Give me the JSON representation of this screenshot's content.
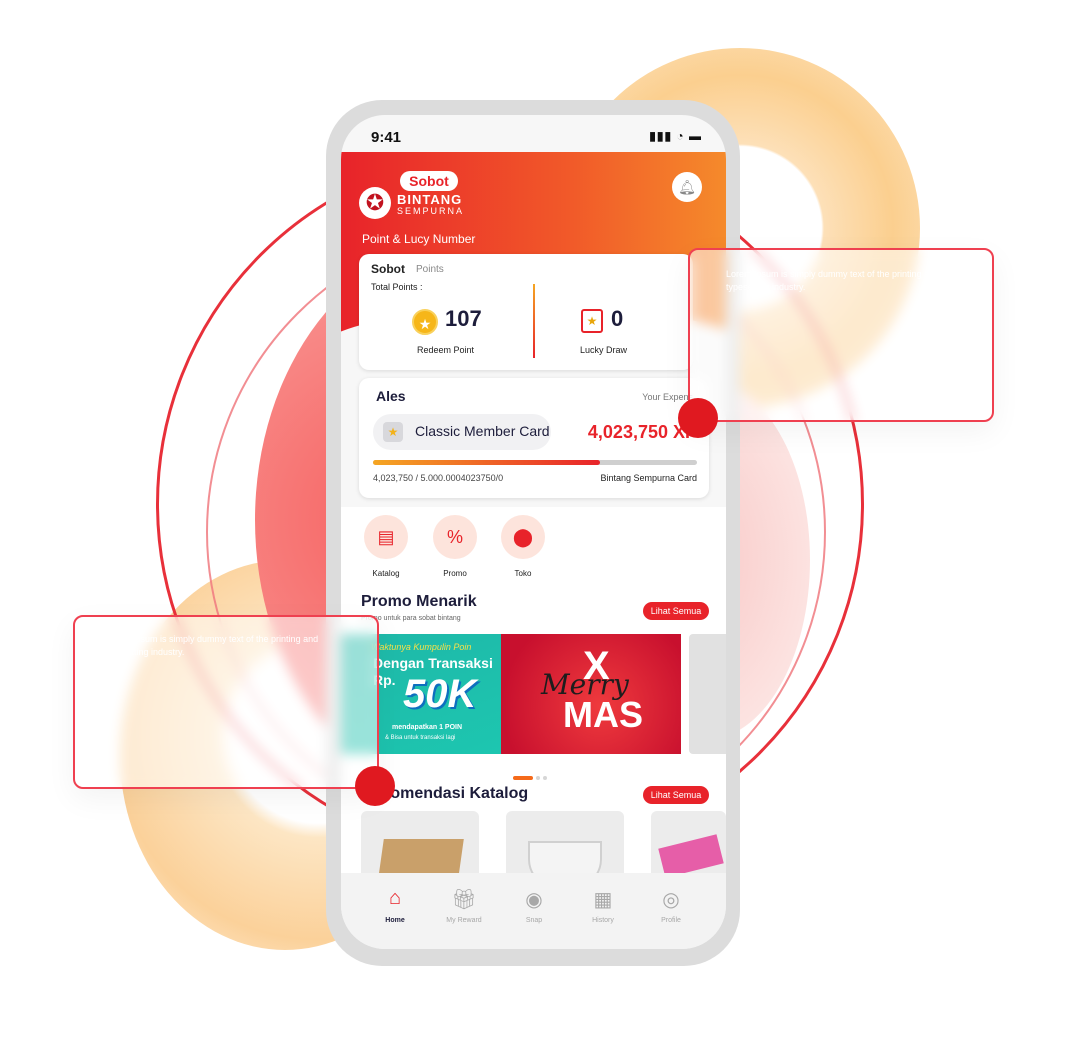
{
  "status_bar": {
    "time": "9:41",
    "icons": "▮▮▮ ◔ ▬"
  },
  "app": {
    "logo_badge": "Sobot",
    "logo_name": "BINTANG",
    "logo_subname": "SEMPURNA",
    "section_title": "Point & Lucy Number"
  },
  "points_card": {
    "brand": "Sobot",
    "brand_sub": "Points",
    "total_label": "Total Points :",
    "redeem_value": "107",
    "redeem_label": "Redeem Point",
    "lucky_value": "0",
    "lucky_label": "Lucky Draw"
  },
  "member_card": {
    "name": "Ales",
    "expense_label": "Your Expens",
    "card_type": "Classic Member Card",
    "amount": "4,023,750 XP",
    "progress_text": "4,023,750 / 5.000.0004023750/0",
    "target_label": "Bintang Sempurna Card",
    "progress_fraction": 0.7
  },
  "menu": [
    {
      "label": "Katalog",
      "icon": "notebook-icon"
    },
    {
      "label": "Promo",
      "icon": "discount-icon"
    },
    {
      "label": "Toko",
      "icon": "location-pin-icon"
    }
  ],
  "promo": {
    "title": "Promo Menarik",
    "subtitle": "Promo untuk para sobat bintang",
    "see_all": "Lihat Semua",
    "banner1": {
      "line1": "Waktunya Kumpulin Poin",
      "line2": "Dengan Transaksi",
      "currency": "Rp.",
      "amount": "50K",
      "note1": "mendapatkan 1 POIN",
      "note2": "& Bisa untuk transaksi lagi"
    },
    "banner2": {
      "top": "X",
      "script": "Merry",
      "bottom": "MAS"
    }
  },
  "rekomendasi": {
    "title": "Rekomendasi Katalog",
    "see_all": "Lihat Semua"
  },
  "tabbar": [
    {
      "label": "Home",
      "icon": "home-icon",
      "active": true
    },
    {
      "label": "My Reward",
      "icon": "gift-icon",
      "active": false
    },
    {
      "label": "Snap",
      "icon": "camera-icon",
      "active": false
    },
    {
      "label": "History",
      "icon": "history-icon",
      "active": false
    },
    {
      "label": "Profile",
      "icon": "profile-icon",
      "active": false
    }
  ],
  "overlays": {
    "right_text": "Lorem Ipsum is simply dummy text of the printing and typesetting industry.",
    "left_text": "Lorem Ipsum is simply dummy text of the printing and typesetting industry."
  },
  "colors": {
    "brand_red": "#e8232a",
    "brand_orange": "#f58a2b",
    "navy": "#1d1d3b"
  }
}
